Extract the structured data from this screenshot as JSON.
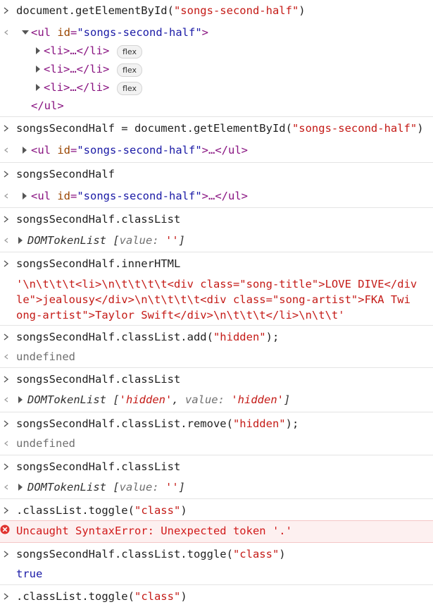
{
  "console": {
    "entries": [
      {
        "input": "document.getElementById(\"songs-second-half\")"
      },
      {
        "input": "songsSecondHalf = document.getElementById(\"songs-second-half\")"
      },
      {
        "input": "songsSecondHalf"
      },
      {
        "input": "songsSecondHalf.classList"
      },
      {
        "input": "songsSecondHalf.innerHTML"
      },
      {
        "input": "songsSecondHalf.classList.add(\"hidden\");"
      },
      {
        "input": "songsSecondHalf.classList"
      },
      {
        "input": "songsSecondHalf.classList.remove(\"hidden\");"
      },
      {
        "input": "songsSecondHalf.classList"
      },
      {
        "input": ".classList.toggle(\"class\")"
      },
      {
        "input": "songsSecondHalf.classList.toggle(\"class\")"
      },
      {
        "input": ".classList.toggle(\"class\")"
      }
    ],
    "ul_open": "<ul id=\"songs-second-half\">",
    "ul_tag_name": "ul",
    "ul_attr_name": "id",
    "ul_attr_value": "songs-second-half",
    "ul_collapsed": "<ul id=\"songs-second-half\">…</ul>",
    "li_collapsed": "<li>…</li>",
    "flex_badge": "flex",
    "ul_close": "</ul>",
    "domtokenlist_label": "DOMTokenList",
    "value_key": "value:",
    "empty_value": "''",
    "hidden_value": "'hidden'",
    "inner_html_lines": [
      "'\\n\\t\\t\\t<li>\\n\\t\\t\\t\\t<div class=\"song-title\">LOVE DIVE</div",
      "le\">jealousy</div>\\n\\t\\t\\t\\t<div class=\"song-artist\">FKA Twi",
      "ong-artist\">Taylor Swift</div>\\n\\t\\t\\t</li>\\n\\t\\t'"
    ],
    "undefined_result": "undefined",
    "true_result": "true",
    "error_message": "Uncaught SyntaxError: Unexpected token '.'"
  }
}
